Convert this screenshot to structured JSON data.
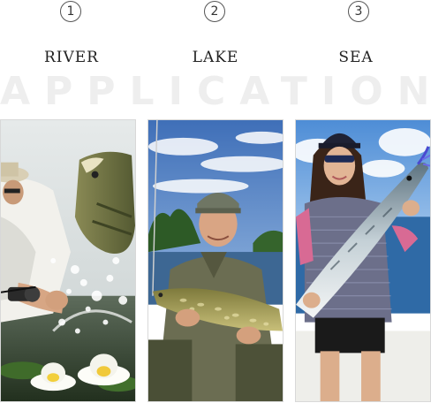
{
  "watermark": "APPLICATION",
  "panels": [
    {
      "number": "1",
      "label": "RIVER"
    },
    {
      "number": "2",
      "label": "LAKE"
    },
    {
      "number": "3",
      "label": "SEA"
    }
  ]
}
